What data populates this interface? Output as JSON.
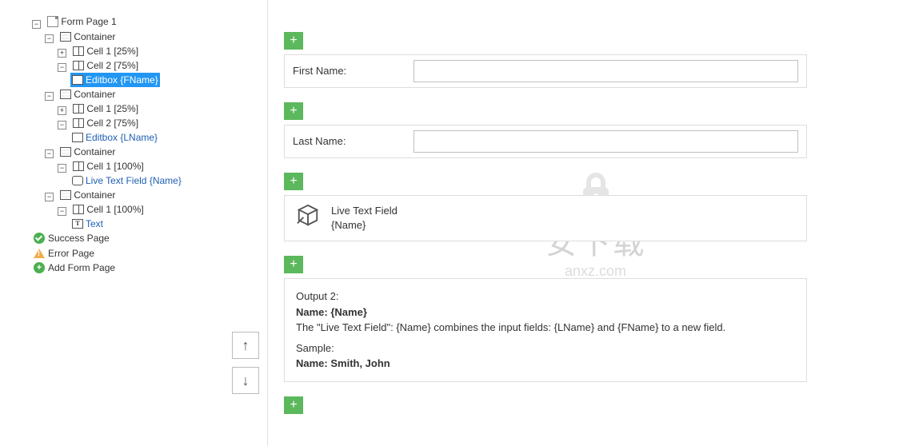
{
  "tree": {
    "form_page": "Form Page 1",
    "container": "Container",
    "cell1_25": "Cell 1 [25%]",
    "cell2_75": "Cell 2 [75%]",
    "editbox_fname": "Editbox {FName}",
    "editbox_lname": "Editbox {LName}",
    "cell1_100": "Cell 1 [100%]",
    "livetext_field": "Live Text Field {Name}",
    "text": "Text",
    "success_page": "Success Page",
    "error_page": "Error Page",
    "add_form_page": "Add Form Page"
  },
  "form": {
    "first_name_label": "First Name:",
    "last_name_label": "Last Name:",
    "first_name_value": "",
    "last_name_value": "",
    "first_name_placeholder": "",
    "last_name_placeholder": ""
  },
  "livetext": {
    "line1": "Live Text Field",
    "line2": "{Name}"
  },
  "output": {
    "heading": "Output 2:",
    "name_label": "Name: {Name}",
    "description": "The \"Live Text Field\": {Name} combines the input fields: {LName} and {FName} to a new field.",
    "sample_label": "Sample:",
    "sample_value": "Name: Smith, John"
  },
  "watermark": {
    "text": "安下载",
    "url": "anxz.com"
  }
}
